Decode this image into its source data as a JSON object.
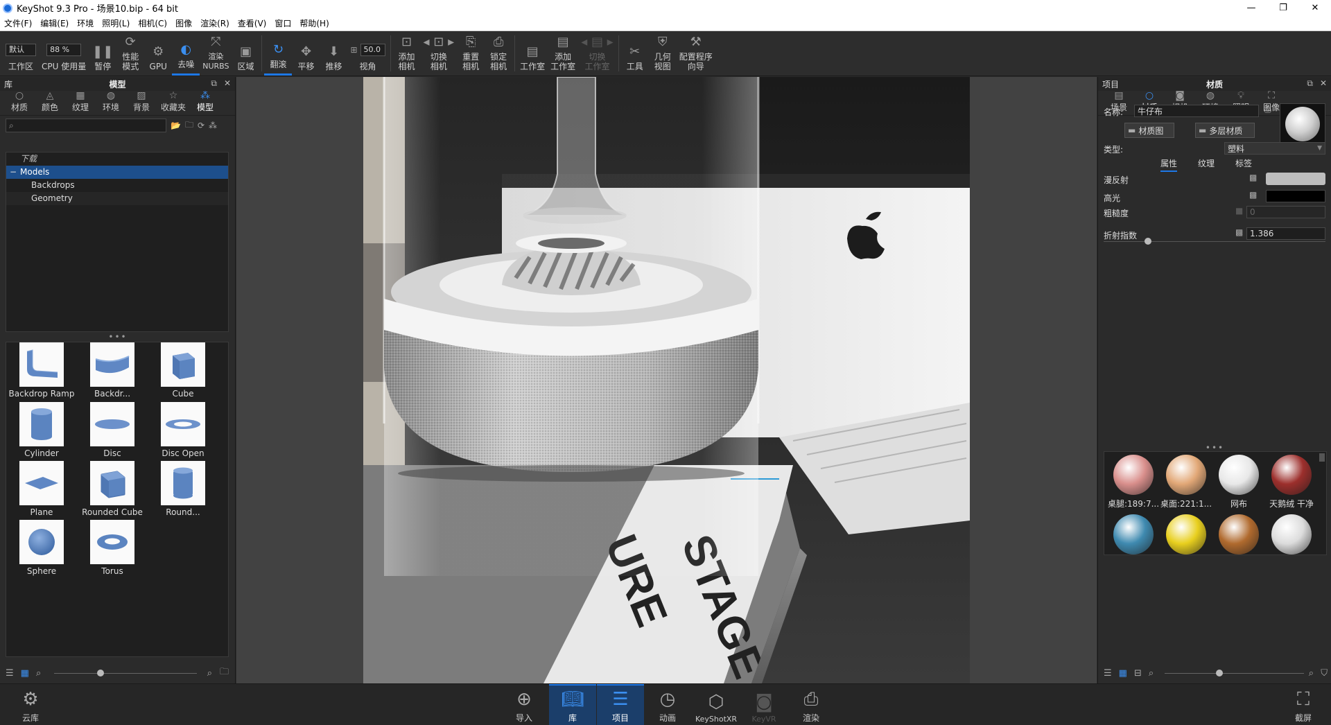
{
  "window": {
    "title": "KeyShot 9.3 Pro  - 场景10.bip  - 64 bit",
    "minimize": "—",
    "restore": "❐",
    "close": "✕"
  },
  "menu": [
    "文件(F)",
    "编辑(E)",
    "环境",
    "照明(L)",
    "相机(C)",
    "图像",
    "渲染(R)",
    "查看(V)",
    "窗口",
    "帮助(H)"
  ],
  "toolbar": {
    "workspace_select": "默认",
    "workspace_label": "工作区",
    "cpu_percent": "88 %",
    "cpu_label": "CPU 使用量",
    "pause": "暂停",
    "perf_mode": "性能\n模式",
    "gpu": "GPU",
    "denoise": "去噪",
    "render_nurbs": "渲染\nNURBS",
    "region": "区域",
    "tumble": "翻滚",
    "pan": "平移",
    "dolly": "推移",
    "fov_value": "50.0",
    "fov": "视角",
    "add_camera": "添加\n相机",
    "switch_camera": "切换\n相机",
    "reset_camera": "重置\n相机",
    "lock_camera": "锁定\n相机",
    "studio": "工作室",
    "add_studio": "添加\n工作室",
    "switch_studio": "切换\n工作室",
    "tools": "工具",
    "geometry_view": "几何\n视图",
    "config_wizard": "配置程序\n向导"
  },
  "library": {
    "panel_left": "库",
    "panel_title": "模型",
    "tabs": [
      "材质",
      "颜色",
      "纹理",
      "环境",
      "背景",
      "收藏夹",
      "模型"
    ],
    "active_tab": "模型",
    "search_placeholder": "",
    "tree": {
      "root": "下载",
      "selected": "Models",
      "children": [
        "Backdrops",
        "Geometry"
      ]
    },
    "models": [
      "Backdrop Ramp",
      "Backdr...",
      "Cube",
      "Cylinder",
      "Disc",
      "Disc Open",
      "Plane",
      "Rounded Cube",
      "Round...",
      "Sphere",
      "Torus"
    ]
  },
  "project": {
    "panel_left": "项目",
    "panel_title": "材质",
    "tabs": [
      "场景",
      "材质",
      "相机",
      "环境",
      "照明",
      "图像"
    ],
    "active_tab": "材质",
    "name_label": "名称:",
    "name_value": "牛仔布",
    "material_graph": "材质图",
    "multi_material": "多层材质",
    "type_label": "类型:",
    "type_value": "塑料",
    "subtabs": [
      "属性",
      "纹理",
      "标签"
    ],
    "active_subtab": "属性",
    "diffuse_label": "漫反射",
    "diffuse_color": "#bdbdbd",
    "specular_label": "高光",
    "specular_color": "#000000",
    "roughness_label": "粗糙度",
    "roughness_value": "0",
    "refraction_label": "折射指数",
    "refraction_value": "1.386",
    "refraction_fraction": 0.2,
    "materials": [
      {
        "label": "桌腿:189:7...",
        "color": "#d98f8c"
      },
      {
        "label": "桌面:221:1...",
        "color": "#e2a877"
      },
      {
        "label": "网布",
        "color": "#e8e8e8"
      },
      {
        "label": "天鹅绒 干净",
        "color": "#9c2f2c"
      },
      {
        "label": "",
        "color": "#3f8ab0"
      },
      {
        "label": "",
        "color": "#e8cf1e"
      },
      {
        "label": "",
        "color": "#b06a2e"
      },
      {
        "label": "",
        "color": "#dcdcdc"
      }
    ]
  },
  "viewport": {
    "book_text": "STAGE\nURE"
  },
  "bottombar": {
    "cloud": "云库",
    "import": "导入",
    "library": "库",
    "project": "项目",
    "animation": "动画",
    "keyshotxr": "KeyShotXR",
    "keyvr": "KeyVR",
    "render": "渲染",
    "screenshot": "截屏"
  },
  "accent_color": "#1e78e6"
}
